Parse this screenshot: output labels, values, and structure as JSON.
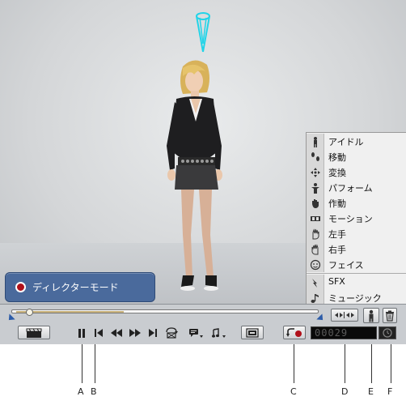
{
  "director_badge": {
    "label": "ディレクターモード"
  },
  "action_menu": {
    "items": [
      {
        "label": "アイドル",
        "icon": "idle-figure-icon"
      },
      {
        "label": "移動",
        "icon": "footsteps-icon"
      },
      {
        "label": "変換",
        "icon": "transform-arrows-icon"
      },
      {
        "label": "パフォーム",
        "icon": "perform-figure-icon"
      },
      {
        "label": "作動",
        "icon": "hand-action-icon"
      },
      {
        "label": "モーション",
        "icon": "film-strip-icon"
      },
      {
        "label": "左手",
        "icon": "left-hand-icon"
      },
      {
        "label": "右手",
        "icon": "right-hand-icon"
      },
      {
        "label": "フェイス",
        "icon": "face-icon"
      },
      {
        "label": "SFX",
        "icon": "sfx-icon"
      },
      {
        "label": "ミュージック",
        "icon": "music-note-icon"
      }
    ]
  },
  "timeline": {
    "progress": 0.02,
    "range_end": 0.37
  },
  "counter": {
    "value": "00029"
  },
  "callouts": {
    "a": "A",
    "b": "B",
    "c": "C",
    "d": "D",
    "e": "E",
    "f": "F"
  },
  "colors": {
    "badge_bg": "#4a6a9c",
    "record_red": "#b0101a",
    "spot_cyan": "#22d4e8",
    "accent_blue": "#2d5ca8"
  }
}
